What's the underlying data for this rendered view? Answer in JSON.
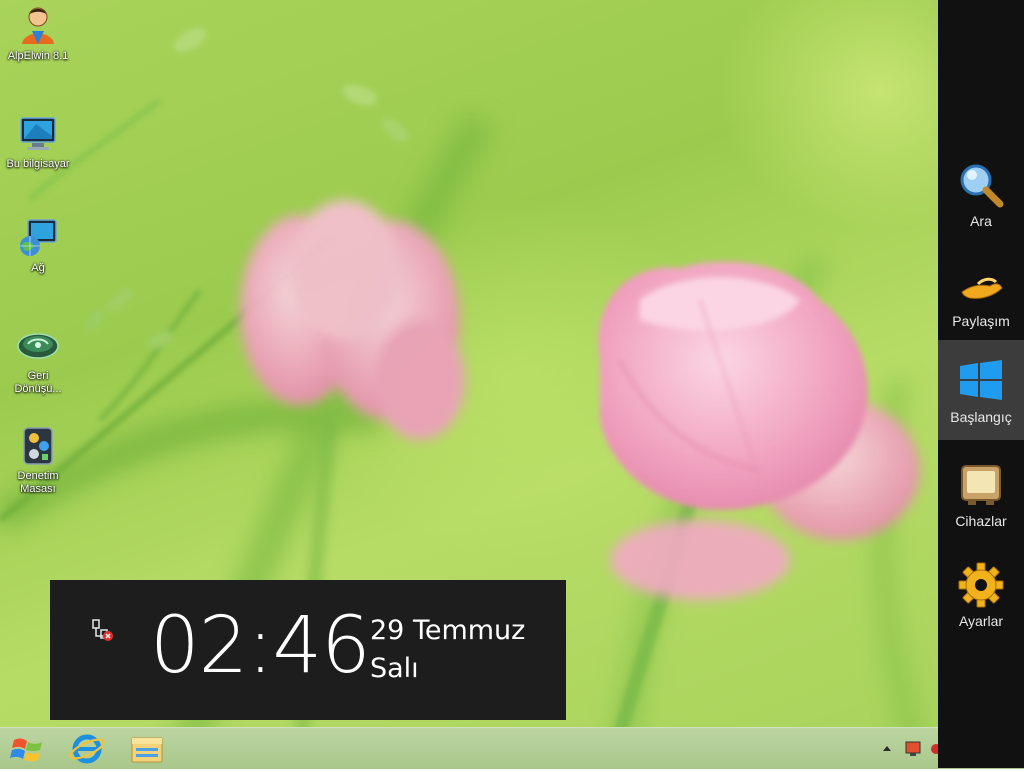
{
  "desktop": {
    "icons": [
      {
        "label": "AlpElwin 8.1"
      },
      {
        "label": "Bu bilgisayar"
      },
      {
        "label": "Ağ"
      },
      {
        "label": "Geri\nDönüşü..."
      },
      {
        "label": "Denetim\nMasası"
      }
    ]
  },
  "clock": {
    "time": "02:46",
    "date": "29 Temmuz",
    "weekday": "Salı",
    "network_icon": "network-disconnected-icon"
  },
  "charms": [
    {
      "label": "Ara",
      "icon": "search-icon"
    },
    {
      "label": "Paylaşım",
      "icon": "share-icon"
    },
    {
      "label": "Başlangıç",
      "icon": "windows-start-icon",
      "active": true
    },
    {
      "label": "Cihazlar",
      "icon": "devices-icon"
    },
    {
      "label": "Ayarlar",
      "icon": "settings-gear-icon"
    }
  ],
  "taskbar": {
    "pinned": [
      {
        "icon": "start-orb-icon"
      },
      {
        "icon": "internet-explorer-icon"
      },
      {
        "icon": "file-explorer-icon"
      }
    ],
    "tray": [
      {
        "icon": "show-hidden-icons-chevron"
      },
      {
        "icon": "action-center-icon"
      },
      {
        "icon": "network-tray-icon"
      }
    ]
  },
  "colors": {
    "wallpaper_green": "#a9d35a",
    "tulip_pink": "#f2a9c4",
    "charms_bg": "#111111",
    "clock_bg": "#1d1d1d"
  }
}
